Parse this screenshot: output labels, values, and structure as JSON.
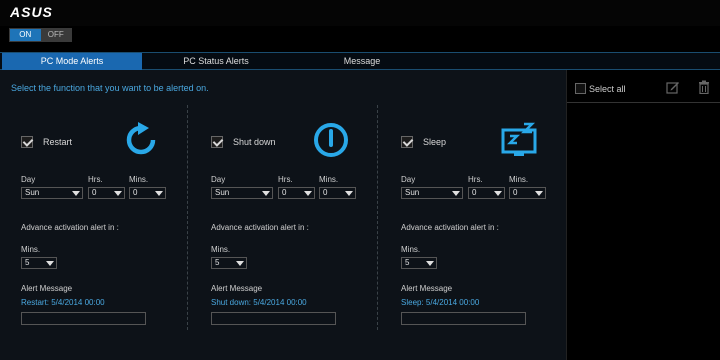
{
  "header": {
    "logo_text": "ASUS"
  },
  "toggle": {
    "on_label": "ON",
    "off_label": "OFF"
  },
  "tabs": [
    {
      "label": "PC Mode Alerts",
      "active": true
    },
    {
      "label": "PC Status Alerts",
      "active": false
    },
    {
      "label": "Message",
      "active": false
    }
  ],
  "instruction": "Select the function that you want to be alerted on.",
  "labels": {
    "day": "Day",
    "hrs": "Hrs.",
    "mins": "Mins.",
    "advance": "Advance activation alert in :",
    "adv_mins": "Mins.",
    "alert_message": "Alert Message"
  },
  "functions": [
    {
      "name": "Restart",
      "checked": true,
      "icon": "restart-icon",
      "day": "Sun",
      "hrs": "0",
      "mins": "0",
      "advance_mins": "5",
      "message": "Restart: 5/4/2014 00:00"
    },
    {
      "name": "Shut down",
      "checked": true,
      "icon": "power-icon",
      "day": "Sun",
      "hrs": "0",
      "mins": "0",
      "advance_mins": "5",
      "message": "Shut down: 5/4/2014 00:00"
    },
    {
      "name": "Sleep",
      "checked": true,
      "icon": "sleep-icon",
      "day": "Sun",
      "hrs": "0",
      "mins": "0",
      "advance_mins": "5",
      "message": "Sleep: 5/4/2014 00:00"
    }
  ],
  "right_panel": {
    "select_all_label": "Select all",
    "edit_icon": "edit-icon",
    "delete_icon": "trash-icon"
  },
  "colors": {
    "accent": "#1e74b8",
    "icon_blue": "#29a8e8",
    "text_blue": "#4aa8e0"
  }
}
